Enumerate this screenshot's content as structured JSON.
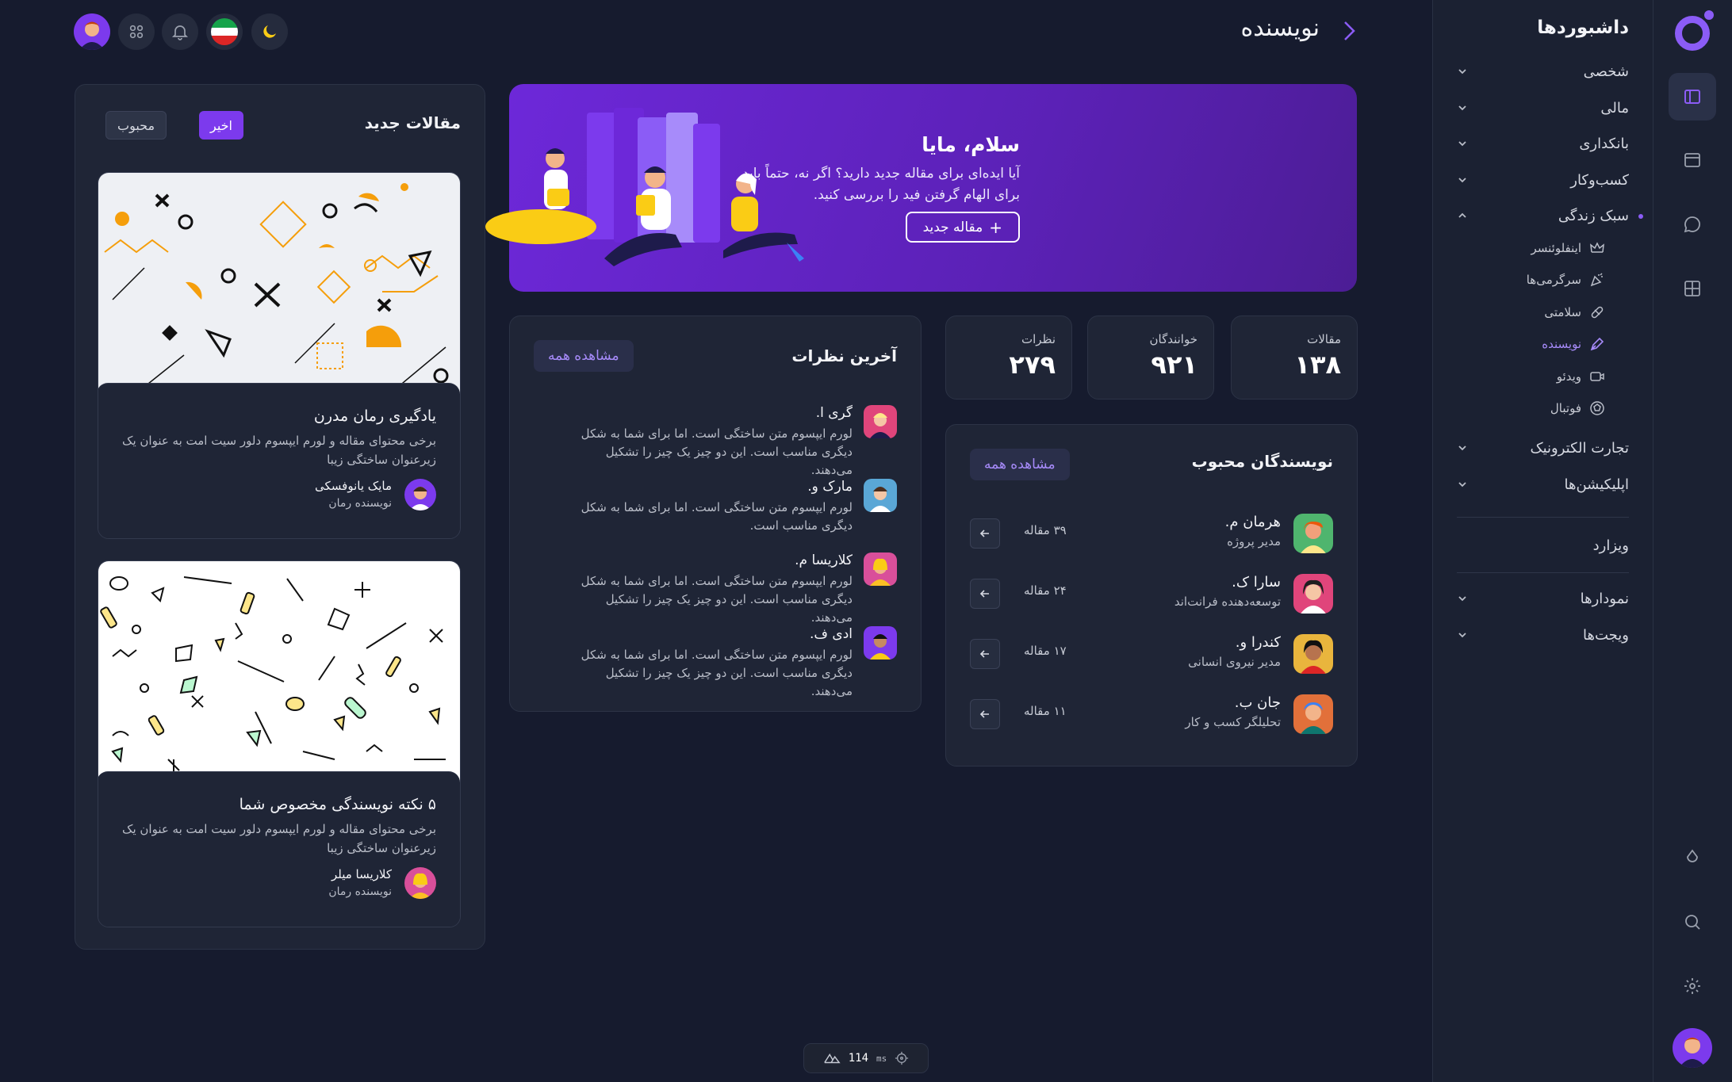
{
  "header": {
    "title": "نویسنده"
  },
  "sidebar": {
    "title": "داشبوردها",
    "items": [
      {
        "label": "شخصی"
      },
      {
        "label": "مالی"
      },
      {
        "label": "بانکداری"
      },
      {
        "label": "کسب‌وکار"
      },
      {
        "label": "سبک زندگی"
      },
      {
        "label": "تجارت الکترونیک"
      },
      {
        "label": "اپلیکیشن‌ها"
      }
    ],
    "lifestyle_children": [
      {
        "label": "اینفلوئنسر",
        "icon": "crown-icon"
      },
      {
        "label": "سرگرمی‌ها",
        "icon": "party-icon"
      },
      {
        "label": "سلامتی",
        "icon": "pill-icon"
      },
      {
        "label": "نویسنده",
        "icon": "pen-icon"
      },
      {
        "label": "ویدئو",
        "icon": "video-icon"
      },
      {
        "label": "فوتبال",
        "icon": "ball-icon"
      }
    ],
    "wizard": "ویزارد",
    "lower_items": [
      {
        "label": "نمودارها"
      },
      {
        "label": "ویجت‌ها"
      }
    ]
  },
  "hero": {
    "title": "سلام، مایا",
    "text": "آیا ایده‌ای برای مقاله جدید دارید؟ اگر نه، حتماً باید برای الهام گرفتن فید را بررسی کنید.",
    "button": "مقاله جدید"
  },
  "stats": [
    {
      "label": "مقالات",
      "value": "۱۳۸"
    },
    {
      "label": "خوانندگان",
      "value": "۹۲۱"
    },
    {
      "label": "نظرات",
      "value": "۲۷۹"
    }
  ],
  "writers": {
    "title": "نویسندگان محبوب",
    "view_all": "مشاهده همه",
    "items": [
      {
        "name": "هرمان م.",
        "role": "مدیر پروژه",
        "count": "۳۹ مقاله",
        "color": "#4fb56e"
      },
      {
        "name": "سارا ک.",
        "role": "توسعه‌دهنده فرانت‌اند",
        "count": "۲۴ مقاله",
        "color": "#e0457b"
      },
      {
        "name": "کندرا و.",
        "role": "مدیر نیروی انسانی",
        "count": "۱۷ مقاله",
        "color": "#e9b53d"
      },
      {
        "name": "جان ب.",
        "role": "تحلیلگر کسب و کار",
        "count": "۱۱ مقاله",
        "color": "#e2703a"
      }
    ]
  },
  "comments": {
    "title": "آخرین نظرات",
    "view_all": "مشاهده همه",
    "items": [
      {
        "name": "گری ا.",
        "text": "لورم ایپسوم متن ساختگی است. اما برای شما به شکل دیگری مناسب است. این دو چیز یک چیز را تشکیل می‌دهند.",
        "color": "#e0457b"
      },
      {
        "name": "مارک و.",
        "text": "لورم ایپسوم متن ساختگی است. اما برای شما به شکل دیگری مناسب است.",
        "color": "#5aa7d6"
      },
      {
        "name": "کلاریسا م.",
        "text": "لورم ایپسوم متن ساختگی است. اما برای شما به شکل دیگری مناسب است. این دو چیز یک چیز را تشکیل می‌دهند.",
        "color": "#d94f9a"
      },
      {
        "name": "ادی ف.",
        "text": "لورم ایپسوم متن ساختگی است. اما برای شما به شکل دیگری مناسب است. این دو چیز یک چیز را تشکیل می‌دهند.",
        "color": "#7c3aed"
      }
    ]
  },
  "articles": {
    "title": "مقالات جدید",
    "tab_recent": "اخیر",
    "tab_popular": "محبوب",
    "items": [
      {
        "title": "یادگیری رمان مدرن",
        "desc": "برخی محتوای مقاله و لورم ایپسوم دلور سیت امت به عنوان یک زیرعنوان ساختگی زیبا",
        "author": "مایک یانوفسکی",
        "role": "نویسنده رمان"
      },
      {
        "title": "۵ نکته نویسندگی مخصوص شما",
        "desc": "برخی محتوای مقاله و لورم ایپسوم دلور سیت امت به عنوان یک زیرعنوان ساختگی زیبا",
        "author": "کلاریسا میلر",
        "role": "نویسنده رمان"
      }
    ]
  },
  "status": {
    "ms_label": "ms",
    "value": "114"
  },
  "colors": {
    "accent": "#7c3aed",
    "background": "#161b2e",
    "panel": "#1f2536"
  }
}
